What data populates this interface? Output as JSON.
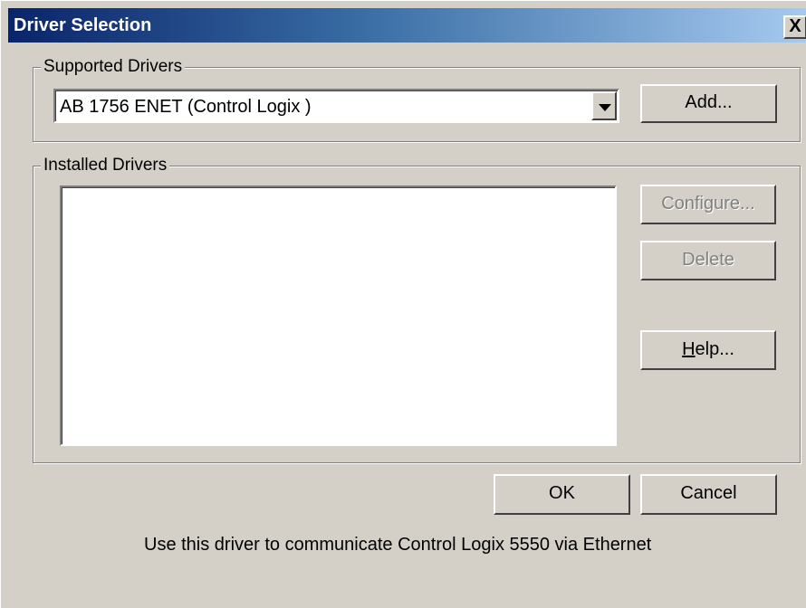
{
  "window": {
    "title": "Driver Selection",
    "close_label": "X"
  },
  "supported": {
    "label": "Supported Drivers",
    "selected_driver": "AB 1756 ENET  (Control Logix )",
    "add_label": "Add..."
  },
  "installed": {
    "label": "Installed Drivers",
    "items": [],
    "configure_label": "Configure...",
    "delete_label": "Delete",
    "help_prefix": "H",
    "help_suffix": "elp..."
  },
  "footer": {
    "ok_label": "OK",
    "cancel_label": "Cancel",
    "description": "Use this driver to communicate Control Logix 5550 via Ethernet"
  }
}
